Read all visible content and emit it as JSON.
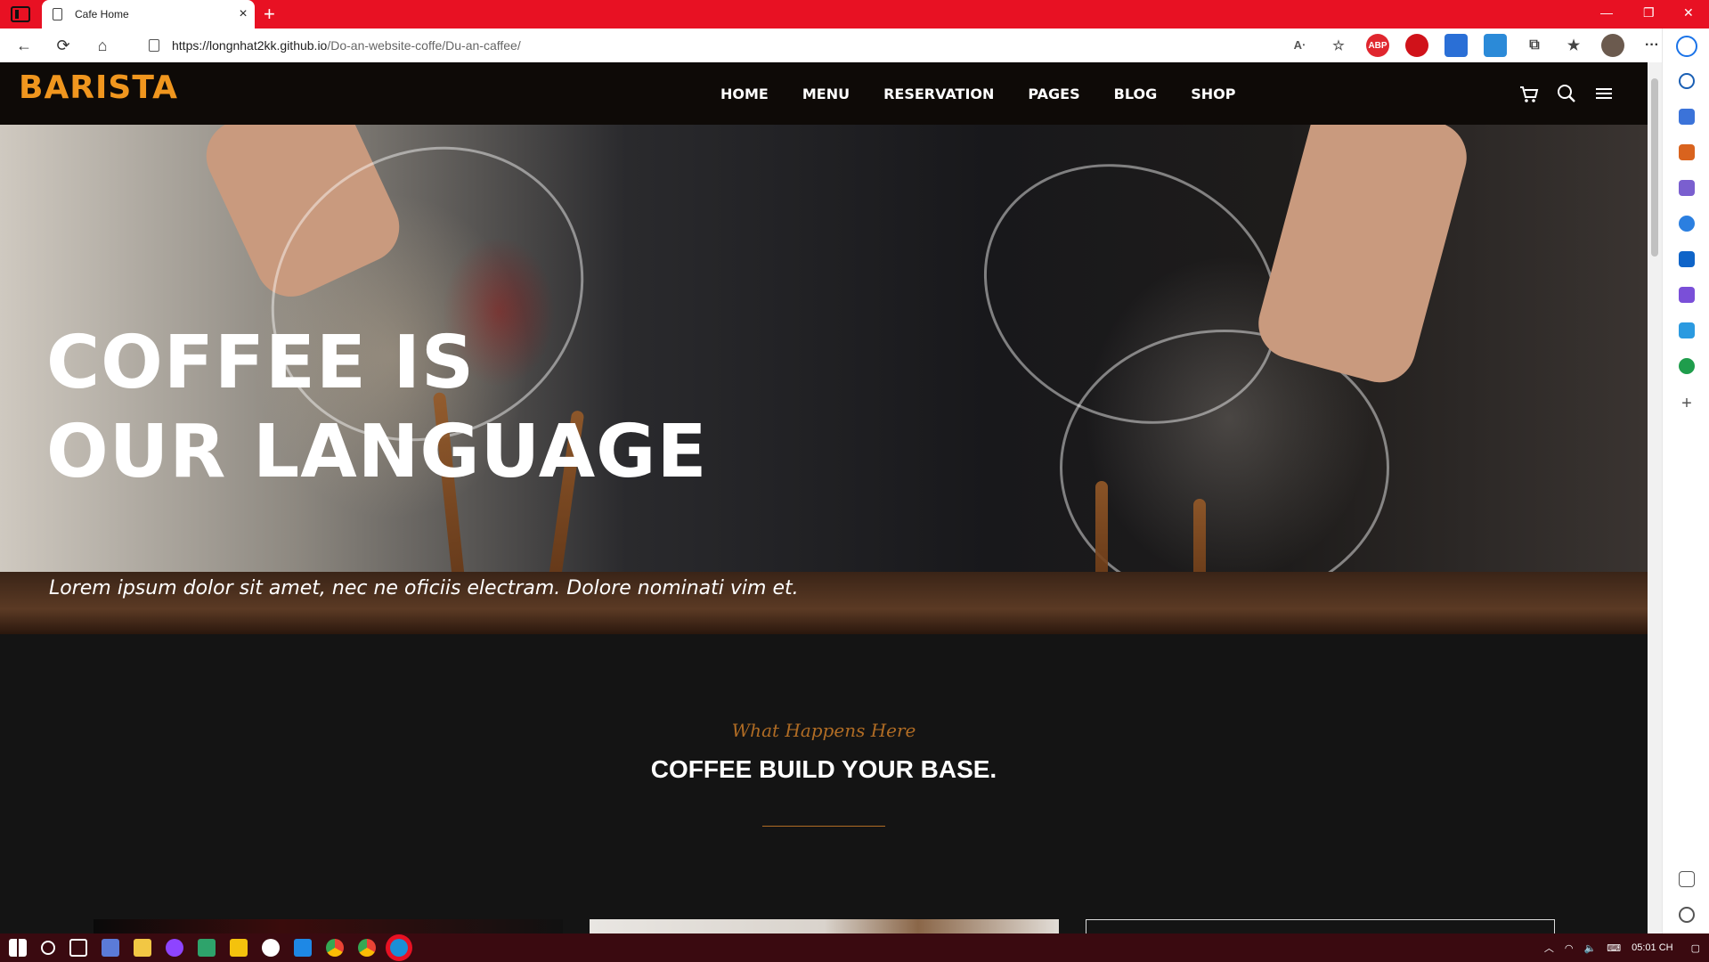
{
  "browser": {
    "tab_title": "Cafe Home",
    "tab_close": "×",
    "new_tab": "+",
    "url_host": "https://longnhat2kk.github.io",
    "url_path": "/Do-an-website-coffe/Du-an-caffee/",
    "minimize": "—",
    "restore": "❐",
    "close": "✕",
    "back": "←",
    "refresh": "⟳",
    "home": "⌂",
    "more": "···",
    "ext_abp": "ABP"
  },
  "site": {
    "logo": "BARISTA",
    "nav": [
      "HOME",
      "MENU",
      "RESERVATION",
      "PAGES",
      "BLOG",
      "SHOP"
    ],
    "hero": {
      "title_line1": "COFFEE IS",
      "title_line2": "OUR LANGUAGE",
      "subtitle": "Lorem ipsum dolor sit amet, nec ne oficiis electram. Dolore nominati vim et."
    },
    "section": {
      "kicker": "What Happens Here",
      "heading": "COFFEE BUILD YOUR BASE."
    }
  },
  "taskbar": {
    "clock": "05:01 CH"
  },
  "colors": {
    "tabstrip": "#e81123",
    "accent": "#f0961e",
    "kicker": "#b06c24",
    "nav_bg": "#0e0a07",
    "page_bg": "#141414",
    "taskbar": "#3a0a10"
  },
  "icons": {
    "cart": "shopping-cart-icon",
    "search": "search-icon",
    "menu": "hamburger-menu-icon"
  }
}
